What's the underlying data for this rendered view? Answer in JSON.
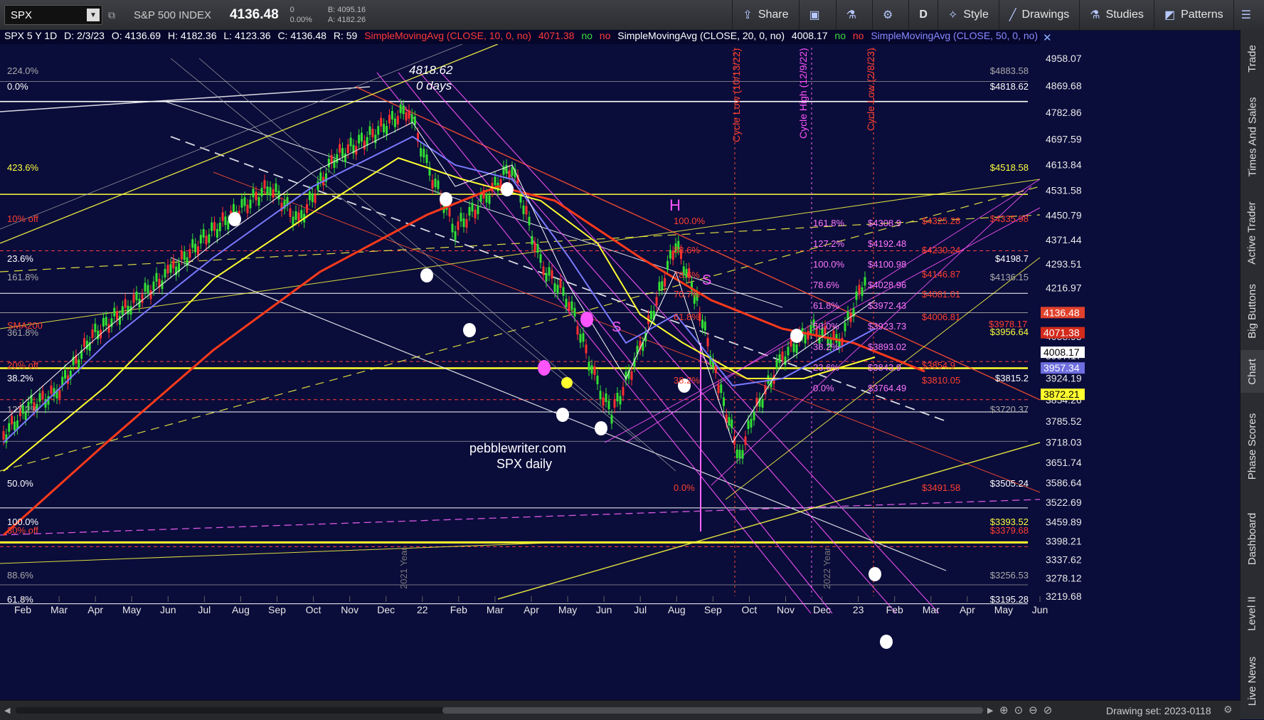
{
  "toolbar": {
    "symbol": "SPX",
    "name": "S&P 500 INDEX",
    "last": "4136.48",
    "change": "0",
    "change_pct": "0.00%",
    "bid": "B: 4095.16",
    "ask": "A: 4182.26",
    "buttons": [
      {
        "icon": "share-icon",
        "label": "Share"
      },
      {
        "icon": "layout-icon",
        "label": ""
      },
      {
        "icon": "flask-icon",
        "label": ""
      },
      {
        "icon": "gear-icon",
        "label": ""
      },
      {
        "icon": "",
        "label": "D"
      },
      {
        "icon": "style-icon",
        "label": "Style"
      },
      {
        "icon": "drawing-icon",
        "label": "Drawings"
      },
      {
        "icon": "studies-icon",
        "label": "Studies"
      },
      {
        "icon": "patterns-icon",
        "label": "Patterns"
      }
    ]
  },
  "infobar": {
    "sym": "SPX 5 Y 1D",
    "date": "D: 2/3/23",
    "open": "O: 4136.69",
    "high": "H: 4182.36",
    "low": "L: 4123.36",
    "close": "C: 4136.48",
    "r": "R: 59",
    "sma10": "SimpleMovingAvg (CLOSE, 10, 0, no)",
    "sma10_val": "4071.38",
    "sma20": "SimpleMovingAvg (CLOSE, 20, 0, no)",
    "sma20_val": "4008.17",
    "sma50": "SimpleMovingAvg (CLOSE, 50, 0, no)",
    "no": "no",
    "more": "..."
  },
  "right_tabs": [
    "Trade",
    "Times And Sales",
    "Active Trader",
    "Big Buttons",
    "Chart",
    "Phase Scores",
    "Dashboard",
    "Level II",
    "Live News"
  ],
  "price_axis": [
    "4958.07",
    "4869.68",
    "4782.86",
    "4697.59",
    "4613.84",
    "4531.58",
    "4450.79",
    "4371.44",
    "4293.51",
    "4216.97",
    "4136.15",
    "4058.95",
    "3997.17",
    "3924.19",
    "3854.26",
    "3785.52",
    "3718.03",
    "3651.74",
    "3586.64",
    "3522.69",
    "3459.89",
    "3398.21",
    "3337.62",
    "3278.12",
    "3219.68"
  ],
  "price_tags": [
    {
      "v": "4136.48",
      "bg": "#e0412c",
      "fg": "#ffffff"
    },
    {
      "v": "4071.38",
      "bg": "#d42a1c",
      "fg": "#ffffff"
    },
    {
      "v": "4008.17",
      "bg": "#ffffff",
      "fg": "#000000"
    },
    {
      "v": "3957.34",
      "bg": "#6e6ee0",
      "fg": "#ffffff"
    },
    {
      "v": "3872.21",
      "bg": "#ffff30",
      "fg": "#000000"
    }
  ],
  "time_axis": [
    "Feb",
    "Mar",
    "Apr",
    "May",
    "Jun",
    "Jul",
    "Aug",
    "Sep",
    "Oct",
    "Nov",
    "Dec",
    "22",
    "Feb",
    "Mar",
    "Apr",
    "May",
    "Jun",
    "Jul",
    "Aug",
    "Sep",
    "Oct",
    "Nov",
    "Dec",
    "23",
    "Feb",
    "Mar",
    "Apr",
    "May",
    "Jun"
  ],
  "fib_left": [
    "224.0%",
    "0.0%",
    "423.6%",
    "10% off",
    "23.6%",
    "161.8%",
    "SMA200",
    "361.8%",
    "20% off",
    "38.2%",
    "127.2%",
    "50.0%",
    "100.0%",
    "30% off",
    "88.6%",
    "61.8%"
  ],
  "right_labels": [
    "$4883.58",
    "$4818.62",
    "$4518.58",
    "$4335.98",
    "$4198.7",
    "$4136.15",
    "$3956.64",
    "$3815.2",
    "$3720.37",
    "$3505.24",
    "$3393.52",
    "$3379.68",
    "$3256.53",
    "$3195.28"
  ],
  "fib_inner": [
    "161.8%",
    "$4308.9",
    "127.2%",
    "$4192.48",
    "100.0%",
    "$4100.98",
    "78.6%",
    "$4028.96",
    "61.8%",
    "$3972.43",
    "50.0%",
    "$3923.73",
    "38.2%",
    "$3893.02",
    "23.6%",
    "$3843.9",
    "0.0%",
    "$3764.49"
  ],
  "fib_red": [
    "$4325.28",
    "$4230.24",
    "$4146.87",
    "$4081.01",
    "$4006.81",
    "$3978.17",
    "$3854.9",
    "$3810.05",
    "$3491.58"
  ],
  "fib_aug": [
    "100.0%",
    "88.6%",
    "78.6%",
    "70.7%",
    "61.8%",
    "38.2%",
    "0.0%"
  ],
  "annotations": {
    "peak_price": "4818.62",
    "peak_days": "0 days",
    "watermark_site": "pebblewriter.com",
    "watermark_title": "SPX daily",
    "cycle_low_1": "Cycle Low (10/13/22)",
    "cycle_high": "Cycle High (12/9/22)",
    "cycle_low_2": "Cycle Low (2/8/23)",
    "year_2021": "2021 Year",
    "year_2022": "2022 Year",
    "h_label": "H",
    "s_label": "S"
  },
  "bottom": {
    "drawing_set": "Drawing set: 2023-0118"
  }
}
